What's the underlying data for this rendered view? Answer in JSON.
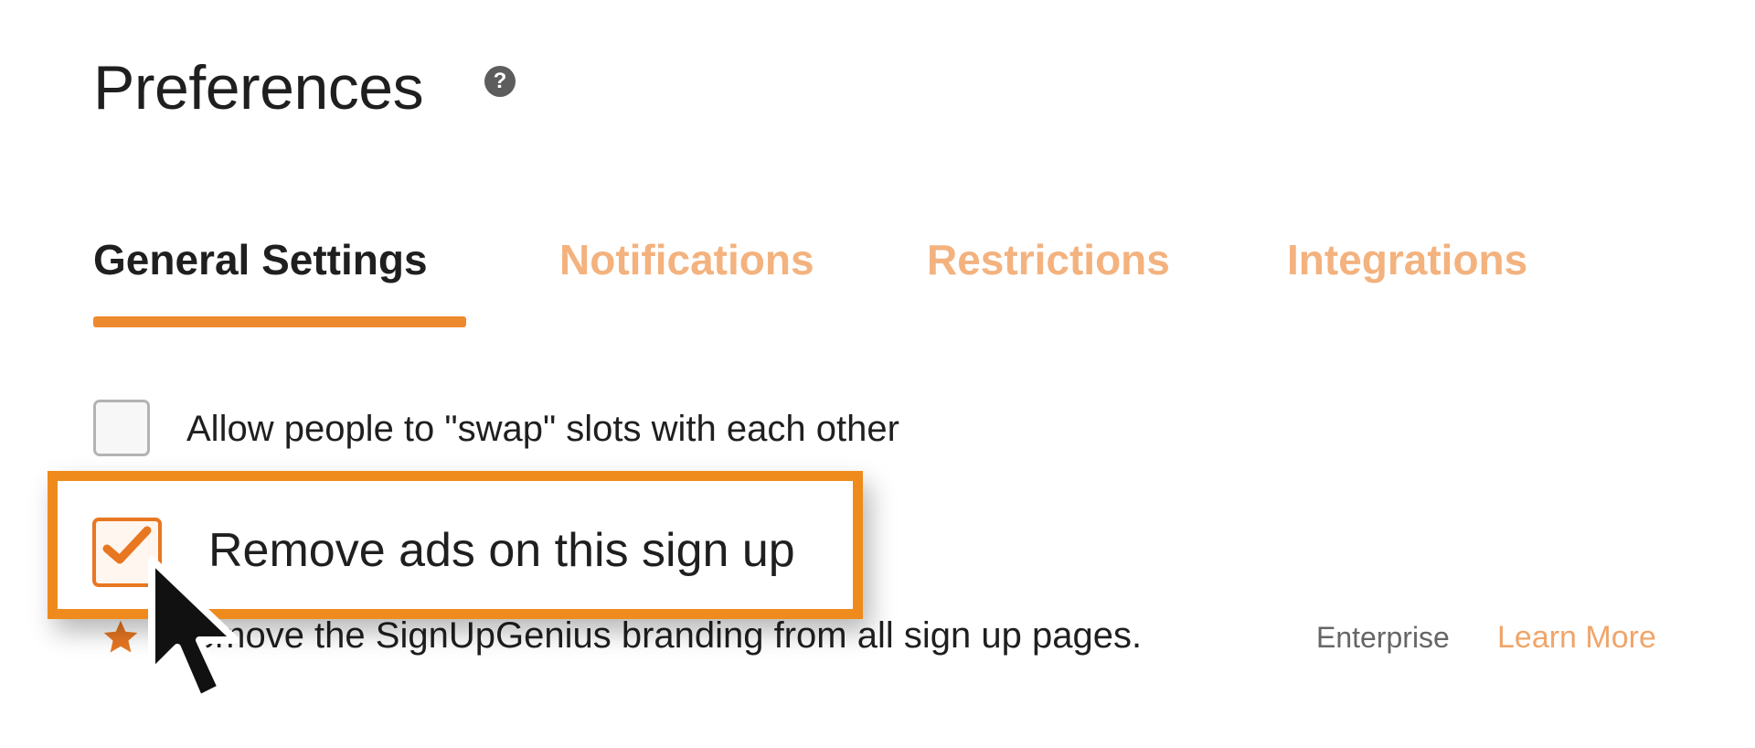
{
  "header": {
    "title": "Preferences",
    "help_icon": "question-circle-icon",
    "help_glyph": "?"
  },
  "tabs": [
    {
      "label": "General Settings",
      "active": true
    },
    {
      "label": "Notifications",
      "active": false
    },
    {
      "label": "Restrictions",
      "active": false
    },
    {
      "label": "Integrations",
      "active": false
    }
  ],
  "options": {
    "swap": {
      "label": "Allow people to \"swap\" slots with each other",
      "checked": false
    },
    "remove_ads": {
      "label": "Remove ads on this sign up",
      "checked": true
    }
  },
  "branding": {
    "text": "Remove the SignUpGenius branding from all sign up pages.",
    "badge": "Enterprise",
    "link": "Learn More",
    "star_icon": "star-icon"
  },
  "colors": {
    "accent": "#ee8a2e",
    "tab_inactive": "#f3b27e",
    "highlight_border": "#ef8b1c",
    "link": "#f0a56a"
  },
  "cursor_icon": "mouse-pointer-icon"
}
